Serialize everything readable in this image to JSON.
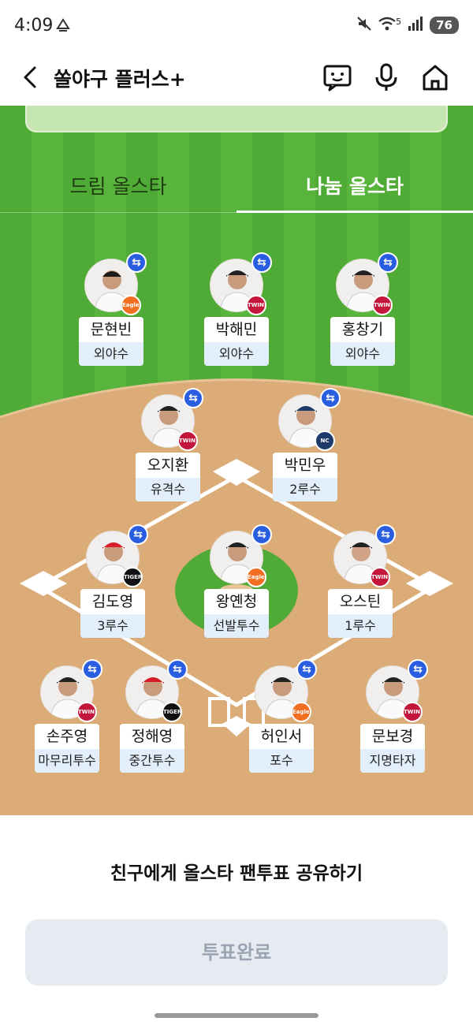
{
  "status_bar": {
    "time": "4:09",
    "signal_label": "5",
    "battery": "76"
  },
  "header": {
    "title": "쏠야구 플러스+"
  },
  "tabs": [
    {
      "label": "드림 올스타",
      "active": false
    },
    {
      "label": "나눔 올스타",
      "active": true
    }
  ],
  "players": [
    {
      "name": "문현빈",
      "position": "외야수",
      "team_logo": "Eagles",
      "logo_color": "#f26f21"
    },
    {
      "name": "박해민",
      "position": "외야수",
      "team_logo": "TWINS",
      "logo_color": "#c4153a"
    },
    {
      "name": "홍창기",
      "position": "외야수",
      "team_logo": "TWINS",
      "logo_color": "#c4153a"
    },
    {
      "name": "오지환",
      "position": "유격수",
      "team_logo": "TWINS",
      "logo_color": "#c4153a"
    },
    {
      "name": "박민우",
      "position": "2루수",
      "team_logo": "NC",
      "logo_color": "#1d3a6b"
    },
    {
      "name": "김도영",
      "position": "3루수",
      "team_logo": "TIGERS",
      "logo_color": "#111111"
    },
    {
      "name": "왕옌청",
      "position": "선발투수",
      "team_logo": "Eagles",
      "logo_color": "#f26f21"
    },
    {
      "name": "오스틴",
      "position": "1루수",
      "team_logo": "TWINS",
      "logo_color": "#c4153a"
    },
    {
      "name": "손주영",
      "position": "마무리투수",
      "team_logo": "TWINS",
      "logo_color": "#c4153a"
    },
    {
      "name": "정해영",
      "position": "중간투수",
      "team_logo": "TIGERS",
      "logo_color": "#111111"
    },
    {
      "name": "허인서",
      "position": "포수",
      "team_logo": "Eagles",
      "logo_color": "#f26f21"
    },
    {
      "name": "문보경",
      "position": "지명타자",
      "team_logo": "TWINS",
      "logo_color": "#c4153a"
    }
  ],
  "swap_icon": "⇆",
  "share": {
    "text": "친구에게 올스타 팬투표 공유하기"
  },
  "vote_button": {
    "label": "투표완료",
    "state": "disabled"
  },
  "colors": {
    "field_green": "#4fab36",
    "infield_dirt": "#dcac78",
    "swap_blue": "#2a5ee0",
    "position_bg": "#e3eefb"
  }
}
